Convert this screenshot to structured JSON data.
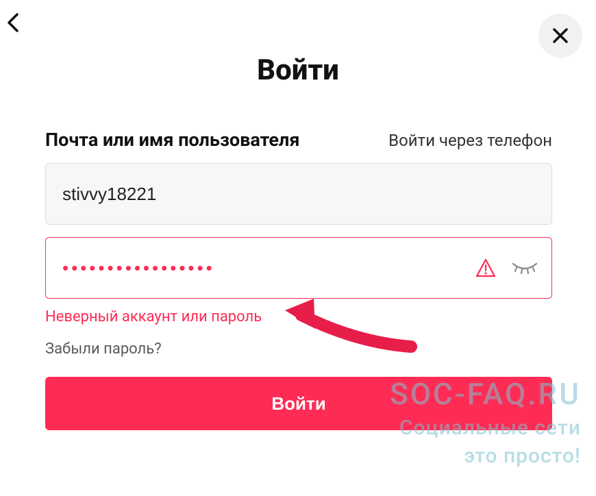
{
  "header": {
    "title": "Войти"
  },
  "form": {
    "username_label": "Почта или имя пользователя",
    "alt_login_label": "Войти через телефон",
    "username_value": "stivvy18221",
    "password_value": "•••••••••••••••••",
    "error_message": "Неверный аккаунт или пароль",
    "forgot_label": "Забыли пароль?",
    "submit_label": "Войти"
  },
  "watermark": {
    "line1": "SOC-FAQ.RU",
    "line2": "Социальные сети",
    "line3": "это просто!"
  }
}
